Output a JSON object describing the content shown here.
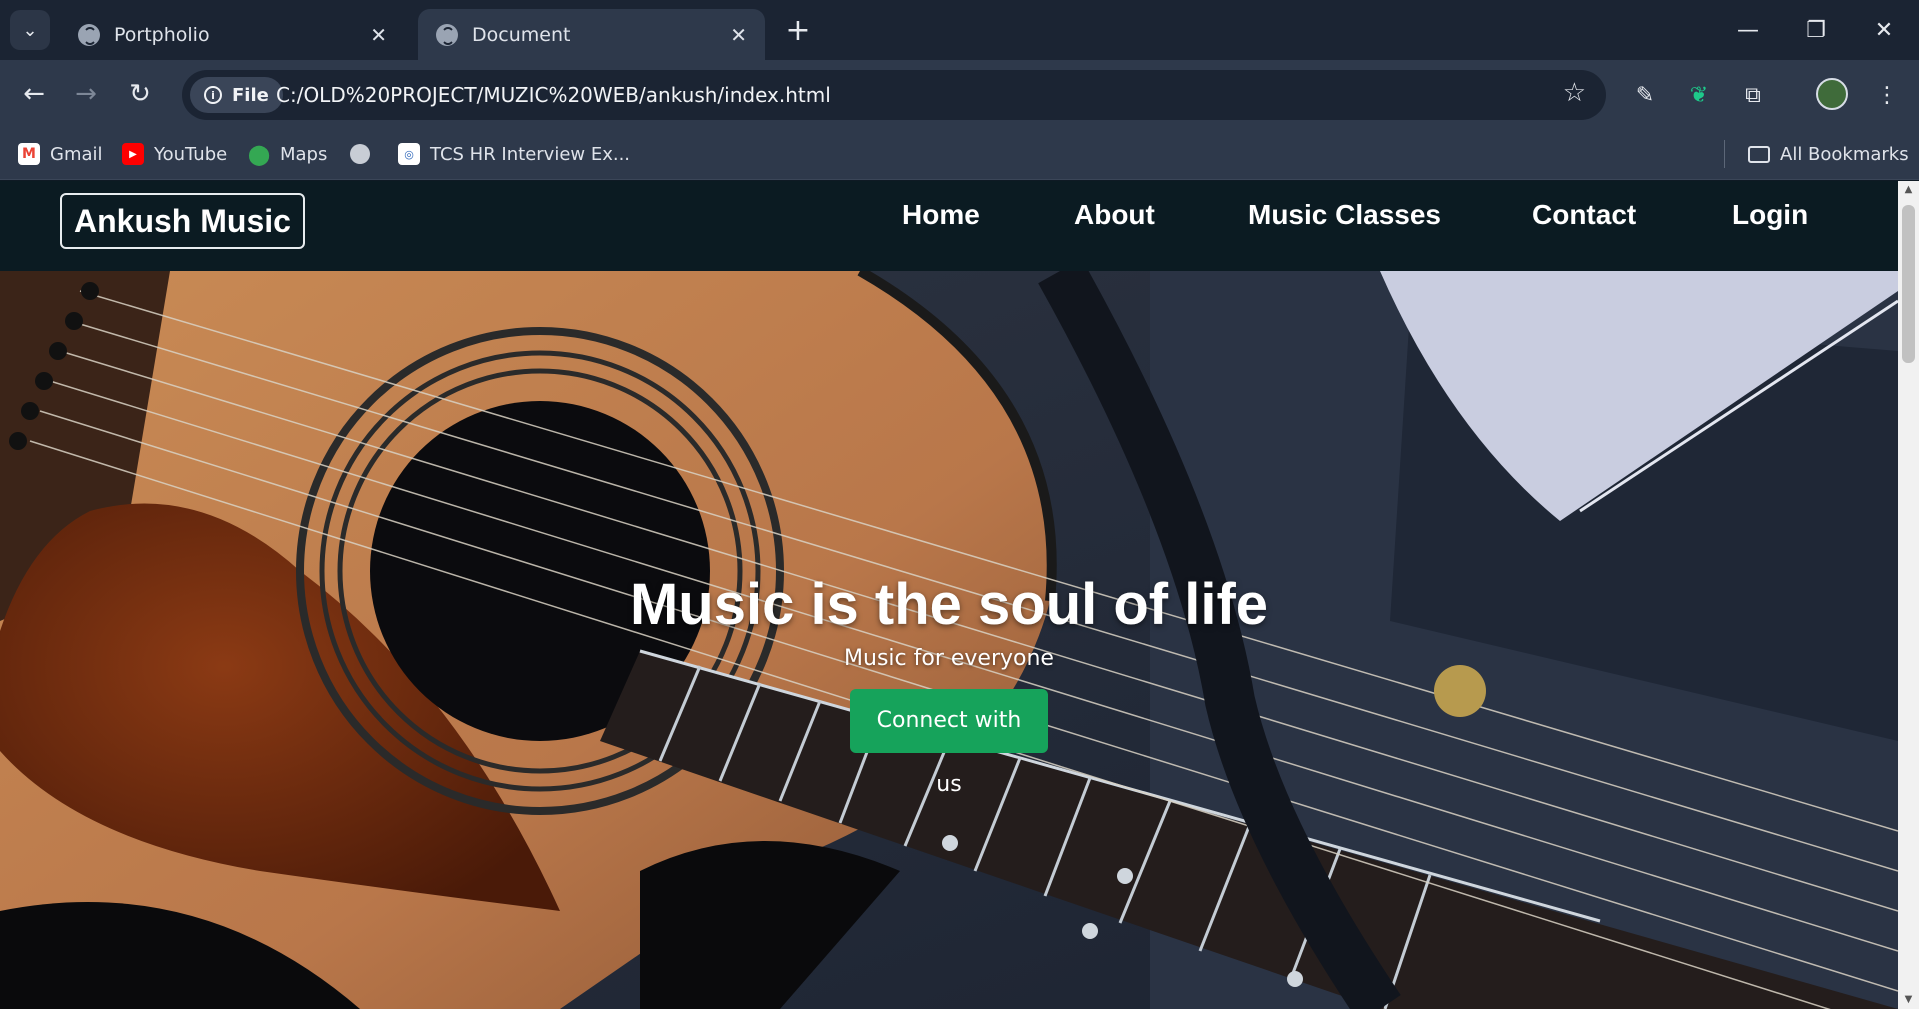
{
  "browser": {
    "tabs": [
      {
        "title": "Portpholio",
        "active": false
      },
      {
        "title": "Document",
        "active": true
      }
    ],
    "address": {
      "scheme_chip": "File",
      "url": "C:/OLD%20PROJECT/MUZIC%20WEB/ankush/index.html"
    },
    "bookmarks": [
      {
        "label": "Gmail",
        "icon": "gmail-icon"
      },
      {
        "label": "YouTube",
        "icon": "youtube-icon"
      },
      {
        "label": "Maps",
        "icon": "maps-icon"
      },
      {
        "label": "",
        "icon": "globe-icon"
      },
      {
        "label": "TCS HR Interview Ex...",
        "icon": "tcs-icon"
      }
    ],
    "all_bookmarks": "All Bookmarks"
  },
  "site": {
    "brand": "Ankush Music",
    "nav": [
      "Home",
      "About",
      "Music Classes",
      "Contact",
      "Login"
    ],
    "hero": {
      "title": "Music is the soul of life",
      "subtitle": "Music for everyone",
      "cta": "Connect with us"
    }
  },
  "colors": {
    "nav_bg": "#0b1b22",
    "cta_bg": "#16a35b",
    "chrome_bg": "#1b2433",
    "toolbar_bg": "#2e394b"
  }
}
